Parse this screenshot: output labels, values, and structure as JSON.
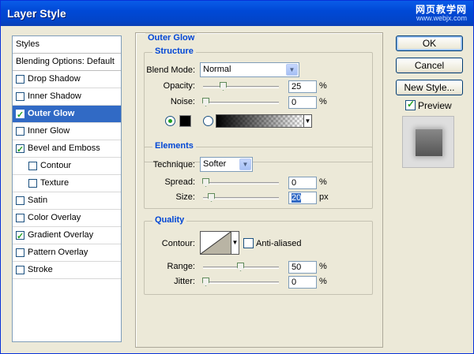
{
  "window": {
    "title": "Layer Style",
    "watermark_line1": "网页教学网",
    "watermark_line2": "www.webjx.com"
  },
  "styles": {
    "header": "Styles",
    "blending": "Blending Options: Default",
    "items": [
      {
        "label": "Drop Shadow",
        "checked": false,
        "selected": false
      },
      {
        "label": "Inner Shadow",
        "checked": false,
        "selected": false
      },
      {
        "label": "Outer Glow",
        "checked": true,
        "selected": true
      },
      {
        "label": "Inner Glow",
        "checked": false,
        "selected": false
      },
      {
        "label": "Bevel and Emboss",
        "checked": true,
        "selected": false
      },
      {
        "label": "Contour",
        "checked": false,
        "selected": false
      },
      {
        "label": "Texture",
        "checked": false,
        "selected": false
      },
      {
        "label": "Satin",
        "checked": false,
        "selected": false
      },
      {
        "label": "Color Overlay",
        "checked": false,
        "selected": false
      },
      {
        "label": "Gradient Overlay",
        "checked": true,
        "selected": false
      },
      {
        "label": "Pattern Overlay",
        "checked": false,
        "selected": false
      },
      {
        "label": "Stroke",
        "checked": false,
        "selected": false
      }
    ]
  },
  "outer_glow": {
    "title": "Outer Glow",
    "structure": {
      "title": "Structure",
      "blend_mode_label": "Blend Mode:",
      "blend_mode": "Normal",
      "opacity_label": "Opacity:",
      "opacity": "25",
      "opacity_unit": "%",
      "noise_label": "Noise:",
      "noise": "0",
      "noise_unit": "%",
      "glow_color": "#000000"
    },
    "elements": {
      "title": "Elements",
      "technique_label": "Technique:",
      "technique": "Softer",
      "spread_label": "Spread:",
      "spread": "0",
      "spread_unit": "%",
      "size_label": "Size:",
      "size": "20",
      "size_unit": "px"
    },
    "quality": {
      "title": "Quality",
      "contour_label": "Contour:",
      "anti_aliased_label": "Anti-aliased",
      "range_label": "Range:",
      "range": "50",
      "range_unit": "%",
      "jitter_label": "Jitter:",
      "jitter": "0",
      "jitter_unit": "%"
    }
  },
  "buttons": {
    "ok": "OK",
    "cancel": "Cancel",
    "new_style": "New Style...",
    "preview": "Preview"
  },
  "colors": {
    "accent": "#0046d5",
    "selection": "#316ac5",
    "titlebar": "#0049d6"
  }
}
